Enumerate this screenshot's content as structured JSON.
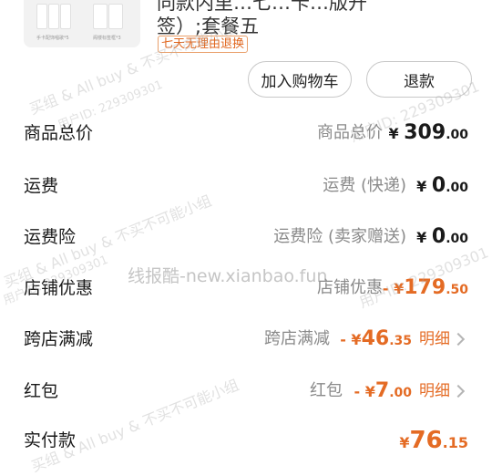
{
  "product": {
    "title_line1": "同款内里…七…卡…版开",
    "title_line2": "签）;套餐五",
    "return_tag": "七天无理由退换",
    "thumb_caption_left": "手卡配饰唱歌*5",
    "thumb_caption_right": "阁楼标签框*3"
  },
  "actions": {
    "add_to_cart": "加入购物车",
    "refund": "退款"
  },
  "rows": [
    {
      "label": "商品总价",
      "sub": "商品总价",
      "sign": "",
      "yen": "¥",
      "int": "309",
      "dec": ".00",
      "detail": ""
    },
    {
      "label": "运费",
      "sub": "运费 (快递)",
      "sign": "",
      "yen": "¥",
      "int": "0",
      "dec": ".00",
      "detail": ""
    },
    {
      "label": "运费险",
      "sub": "运费险 (卖家赠送)",
      "sign": "",
      "yen": "¥",
      "int": "0",
      "dec": ".00",
      "detail": ""
    },
    {
      "label": "店铺优惠",
      "sub": "店铺优惠",
      "sign": "-",
      "yen": "¥",
      "int": "179",
      "dec": ".50",
      "detail": ""
    },
    {
      "label": "跨店满减",
      "sub": "跨店满减",
      "sign": "-",
      "yen": "¥",
      "int": "46",
      "dec": ".35",
      "detail": "明细"
    },
    {
      "label": "红包",
      "sub": "红包",
      "sign": "-",
      "yen": "¥",
      "int": "7",
      "dec": ".00",
      "detail": "明细"
    }
  ],
  "total": {
    "label": "实付款",
    "yen": "¥",
    "int": "76",
    "dec": ".15"
  },
  "watermarks": {
    "group_text": "买组 & All buy & 不买不可能小组",
    "user_id": "用户ID: 229309301",
    "site": "线报酷-new.xianbao.fun"
  }
}
